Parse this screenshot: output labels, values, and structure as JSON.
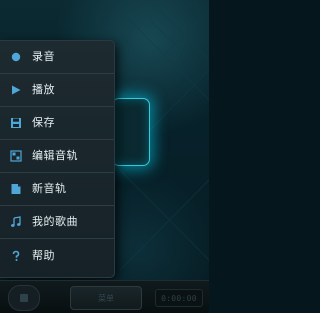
{
  "menu": {
    "items": [
      {
        "label": "录音",
        "icon": "record-circle-icon"
      },
      {
        "label": "播放",
        "icon": "play-icon"
      },
      {
        "label": "保存",
        "icon": "save-icon"
      },
      {
        "label": "编辑音轨",
        "icon": "edit-track-icon"
      },
      {
        "label": "新音轨",
        "icon": "new-track-icon"
      },
      {
        "label": "我的歌曲",
        "icon": "music-note-icon"
      },
      {
        "label": "帮助",
        "icon": "help-icon"
      }
    ]
  },
  "bottom_bar": {
    "menu_label": "菜单",
    "timer_text": "0:00:00"
  },
  "colors": {
    "glow_accent": "#2fe0f0",
    "menu_text": "#e6f0f3",
    "icon_color": "#4fa7d8"
  }
}
